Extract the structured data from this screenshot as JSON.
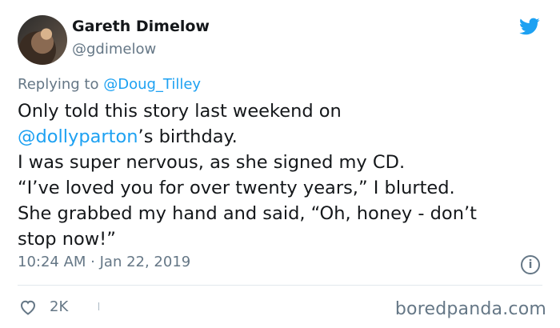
{
  "tweet": {
    "author_name": "Gareth Dimelow",
    "author_handle": "@gdimelow",
    "replying_to_prefix": "Replying to ",
    "replying_to_handle": "@Doug_Tilley",
    "body_lines": [
      {
        "text": "Only told this story last weekend on"
      },
      {
        "mention": "@dollyparton",
        "text": "’s birthday."
      },
      {
        "text": "I was super nervous, as she signed my CD."
      },
      {
        "text": "“I’ve loved you for over twenty years,” I blurted."
      },
      {
        "text": "She grabbed my hand and said, “Oh, honey - don’t"
      },
      {
        "text": "stop now!”"
      }
    ],
    "timestamp": "10:24 AM · Jan 22, 2019",
    "like_count": "2K",
    "info_glyph": "i"
  },
  "watermark": "boredpanda.com",
  "icons": {
    "avatar": "profile-photo",
    "bird": "twitter-bird-icon",
    "info": "info-icon",
    "like": "heart-icon"
  },
  "colors": {
    "link": "#1da1f2",
    "muted": "#657786",
    "text": "#14171a",
    "divider": "#e1e8ed"
  }
}
